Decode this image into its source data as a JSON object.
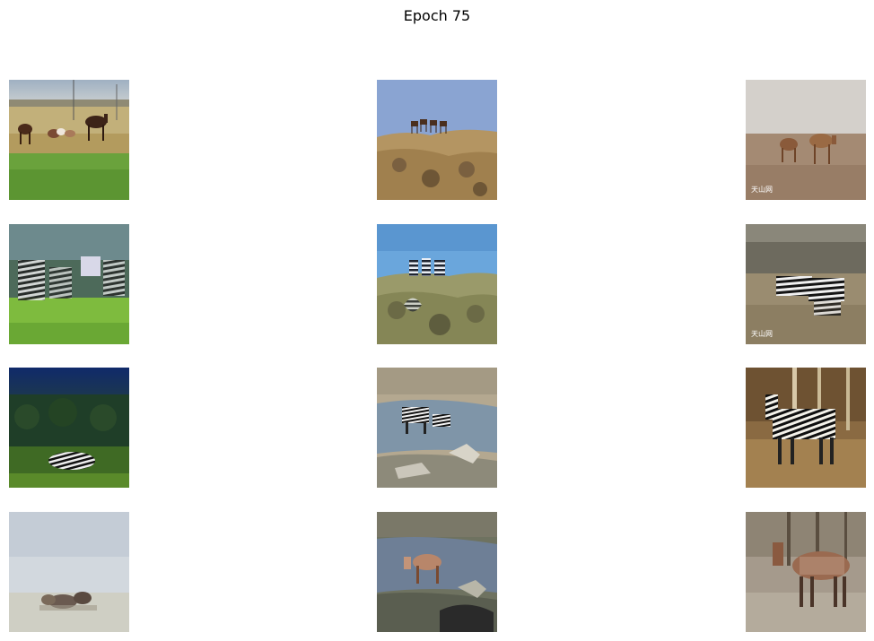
{
  "figure": {
    "title": "Epoch 75"
  },
  "grid": {
    "rows": 4,
    "cols": 3,
    "images": [
      {
        "id": "r0c0",
        "desc": "horses grazing in grass field"
      },
      {
        "id": "r0c1",
        "desc": "horses on rocky hilltop under blue sky"
      },
      {
        "id": "r0c2",
        "desc": "two horses on dry plain",
        "watermark": "天山网"
      },
      {
        "id": "r1c0",
        "desc": "zebra-striped translated horses in field"
      },
      {
        "id": "r1c1",
        "desc": "zebra-striped translated horses on rocky hill"
      },
      {
        "id": "r1c2",
        "desc": "zebra-striped translated horses on plain",
        "watermark": "天山网"
      },
      {
        "id": "r2c0",
        "desc": "zebra lying in grass at dusk"
      },
      {
        "id": "r2c1",
        "desc": "zebras at waterhole"
      },
      {
        "id": "r2c2",
        "desc": "zebra among dry trees"
      },
      {
        "id": "r3c0",
        "desc": "horse-translated zebras in pale scene"
      },
      {
        "id": "r3c1",
        "desc": "horse-translated zebra at waterhole"
      },
      {
        "id": "r3c2",
        "desc": "horse-translated zebra among trees"
      }
    ]
  }
}
